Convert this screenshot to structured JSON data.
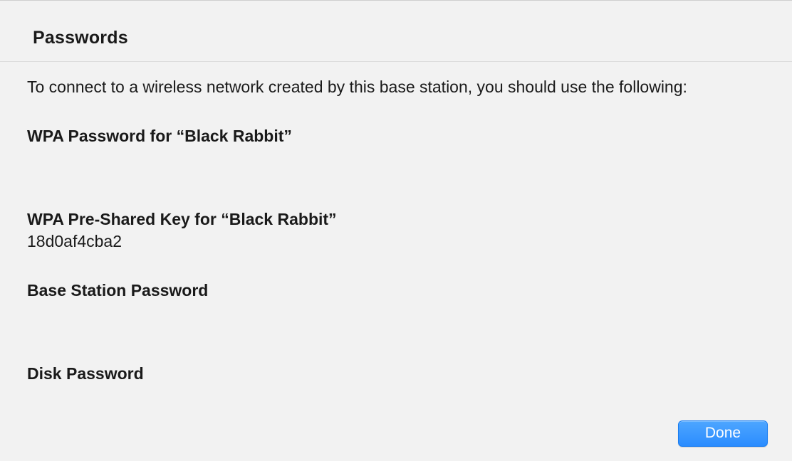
{
  "header": {
    "title": "Passwords"
  },
  "content": {
    "intro": "To connect to a wireless network created by this base station, you should use the following:",
    "sections": {
      "wpa_password": {
        "title": "WPA Password for “Black Rabbit”"
      },
      "wpa_psk": {
        "title": "WPA Pre-Shared Key for “Black Rabbit”",
        "value": "18d0af4cba2"
      },
      "base_station": {
        "title": "Base Station Password"
      },
      "disk": {
        "title": "Disk Password"
      }
    }
  },
  "footer": {
    "done_label": "Done"
  }
}
